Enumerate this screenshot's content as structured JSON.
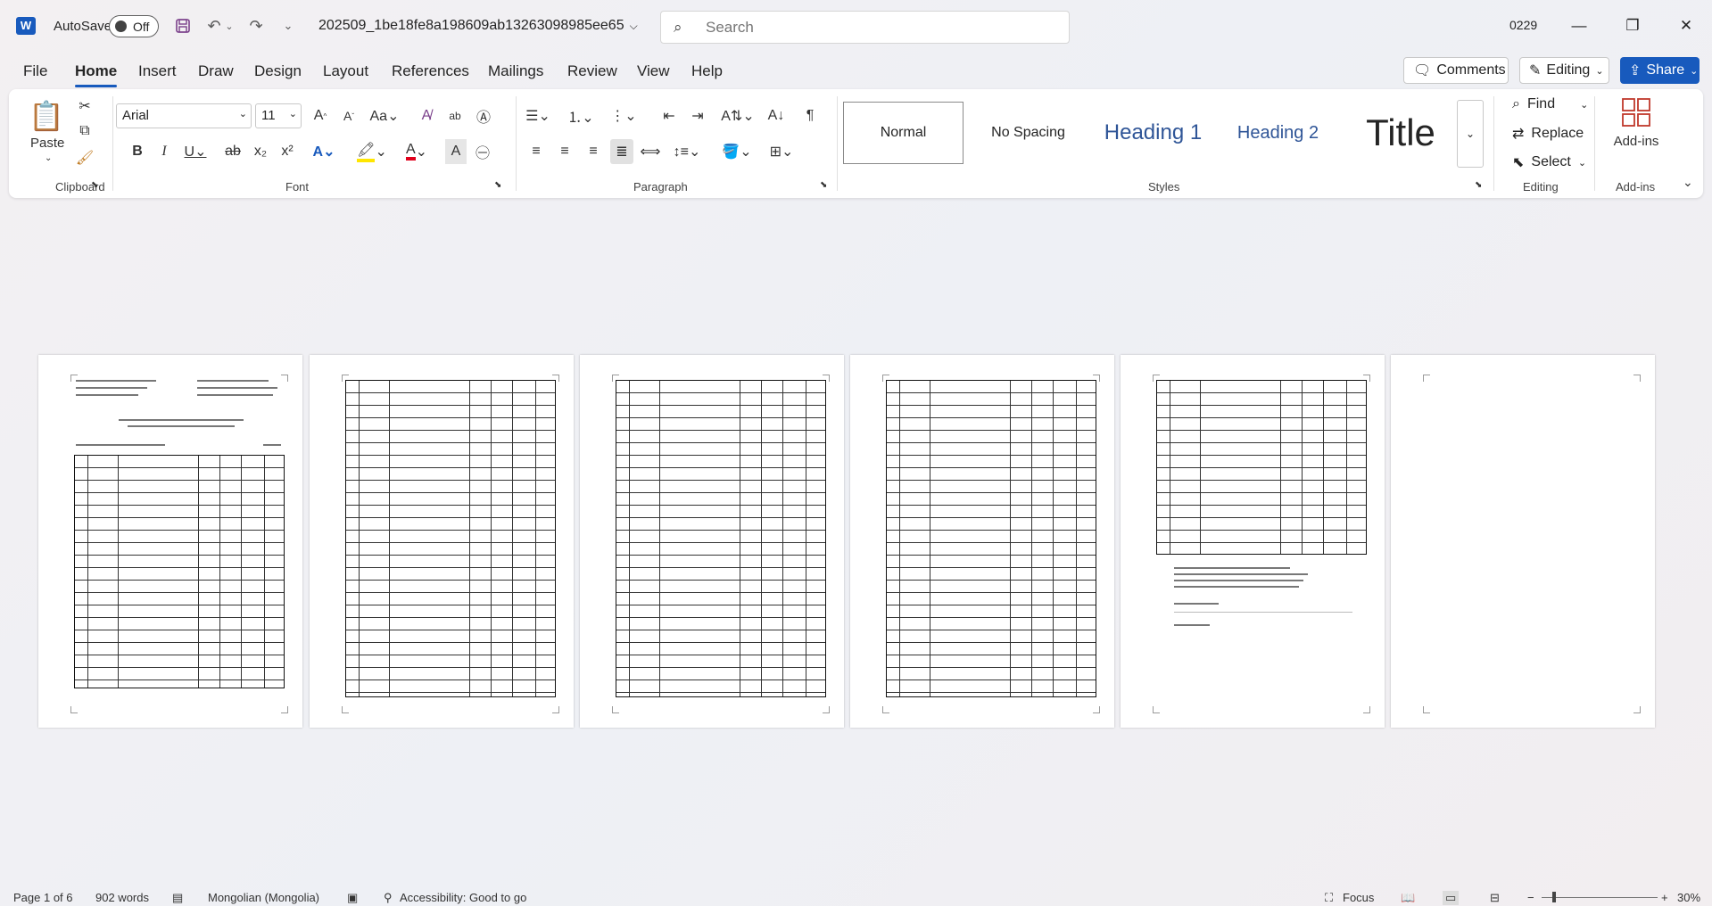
{
  "titlebar": {
    "app_logo": "W",
    "autosave_label": "AutoSave",
    "autosave_state": "Off",
    "doc_title": "202509_1be18fe8a198609ab13263098985ee65",
    "search_placeholder": "Search",
    "user_badge": "0229"
  },
  "tabs": [
    "File",
    "Home",
    "Insert",
    "Draw",
    "Design",
    "Layout",
    "References",
    "Mailings",
    "Review",
    "View",
    "Help"
  ],
  "active_tab": "Home",
  "header_buttons": {
    "comments": "Comments",
    "editing": "Editing",
    "share": "Share"
  },
  "ribbon": {
    "clipboard": {
      "paste": "Paste",
      "label": "Clipboard"
    },
    "font": {
      "name": "Arial",
      "size": "11",
      "label": "Font"
    },
    "paragraph": {
      "label": "Paragraph"
    },
    "styles": {
      "items": [
        "Normal",
        "No Spacing",
        "Heading 1",
        "Heading 2",
        "Title"
      ],
      "label": "Styles"
    },
    "editing": {
      "find": "Find",
      "replace": "Replace",
      "select": "Select",
      "label": "Editing"
    },
    "addins": {
      "button": "Add-ins",
      "label": "Add-ins"
    }
  },
  "pages": {
    "count": 6
  },
  "statusbar": {
    "page": "Page 1 of 6",
    "words": "902 words",
    "language": "Mongolian (Mongolia)",
    "accessibility": "Accessibility: Good to go",
    "focus": "Focus",
    "zoom": "30%"
  },
  "colors": {
    "accent": "#185abd"
  }
}
